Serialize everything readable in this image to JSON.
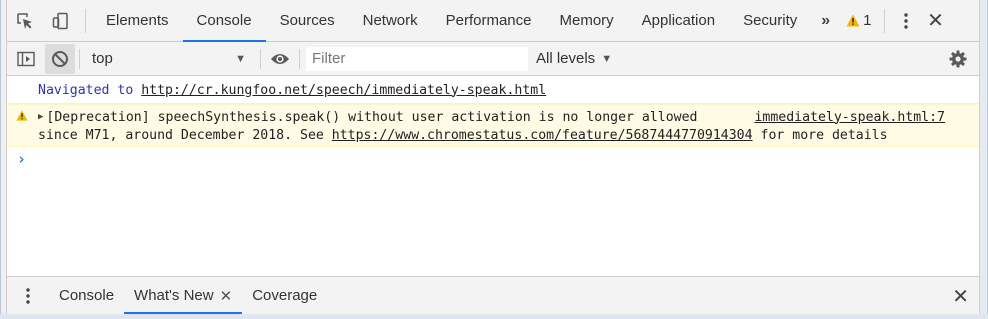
{
  "tabbar": {
    "tabs": [
      {
        "label": "Elements",
        "active": false
      },
      {
        "label": "Console",
        "active": true
      },
      {
        "label": "Sources",
        "active": false
      },
      {
        "label": "Network",
        "active": false
      },
      {
        "label": "Performance",
        "active": false
      },
      {
        "label": "Memory",
        "active": false
      },
      {
        "label": "Application",
        "active": false
      },
      {
        "label": "Security",
        "active": false
      }
    ],
    "more_tabs": "»",
    "warning_count": "1",
    "close": "✕"
  },
  "toolbar": {
    "context": "top",
    "filter_placeholder": "Filter",
    "filter_value": "",
    "levels": "All levels"
  },
  "console": {
    "nav_prefix": "Navigated to ",
    "nav_url": "http://cr.kungfoo.net/speech/immediately-speak.html",
    "warning": {
      "line1": "[Deprecation] speechSynthesis.speak() without user activation is no longer allowed",
      "source": "immediately-speak.html:7",
      "line2_prefix": "since M71, around December 2018. See ",
      "line2_url": "https://www.chromestatus.com/feature/5687444770914304",
      "line2_suffix": " for more details"
    },
    "prompt": "›"
  },
  "drawer": {
    "tabs": [
      {
        "label": "Console",
        "active": false
      },
      {
        "label": "What's New",
        "active": true,
        "closable": true
      },
      {
        "label": "Coverage",
        "active": false
      }
    ],
    "tab_close": "✕",
    "close": "✕"
  },
  "colors": {
    "accent": "#1a73e8",
    "warning_bg": "#fffbe5",
    "warning_icon": "#f2b600",
    "nav_text": "#3333aa"
  }
}
